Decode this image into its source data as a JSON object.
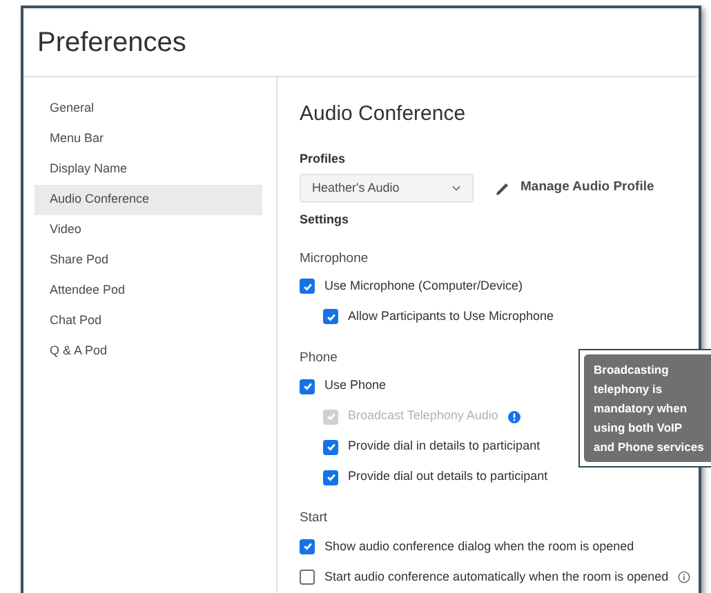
{
  "window": {
    "title": "Preferences"
  },
  "sidebar": {
    "items": [
      {
        "label": "General",
        "selected": false
      },
      {
        "label": "Menu Bar",
        "selected": false
      },
      {
        "label": "Display Name",
        "selected": false
      },
      {
        "label": "Audio Conference",
        "selected": true
      },
      {
        "label": "Video",
        "selected": false
      },
      {
        "label": "Share Pod",
        "selected": false
      },
      {
        "label": "Attendee Pod",
        "selected": false
      },
      {
        "label": "Chat Pod",
        "selected": false
      },
      {
        "label": "Q & A Pod",
        "selected": false
      }
    ]
  },
  "content": {
    "heading": "Audio Conference",
    "profiles_label": "Profiles",
    "profile_select": {
      "value": "Heather's Audio"
    },
    "manage_link": "Manage Audio Profile",
    "settings_label": "Settings",
    "sections": [
      {
        "title": "Microphone",
        "options": [
          {
            "label": "Use Microphone (Computer/Device)",
            "checked": true,
            "disabled": false,
            "children": [
              {
                "label": "Allow Participants to Use Microphone",
                "checked": true,
                "disabled": false
              }
            ]
          }
        ]
      },
      {
        "title": "Phone",
        "options": [
          {
            "label": "Use Phone",
            "checked": true,
            "disabled": false,
            "children": [
              {
                "label": "Broadcast Telephony Audio",
                "checked": true,
                "disabled": true,
                "kind": "help"
              },
              {
                "label": "Provide dial in details to participant",
                "checked": true,
                "disabled": false
              },
              {
                "label": "Provide dial out details to participant",
                "checked": true,
                "disabled": false
              }
            ]
          }
        ]
      },
      {
        "title": "Start",
        "options": [
          {
            "label": "Show audio conference dialog when the room is opened",
            "checked": true,
            "disabled": false
          },
          {
            "label": "Start audio conference automatically when the room is opened",
            "checked": false,
            "disabled": false,
            "kind": "info"
          }
        ]
      }
    ]
  },
  "tooltip": {
    "text": "Broadcasting telephony is mandatory when using both VoIP and Phone services"
  }
}
